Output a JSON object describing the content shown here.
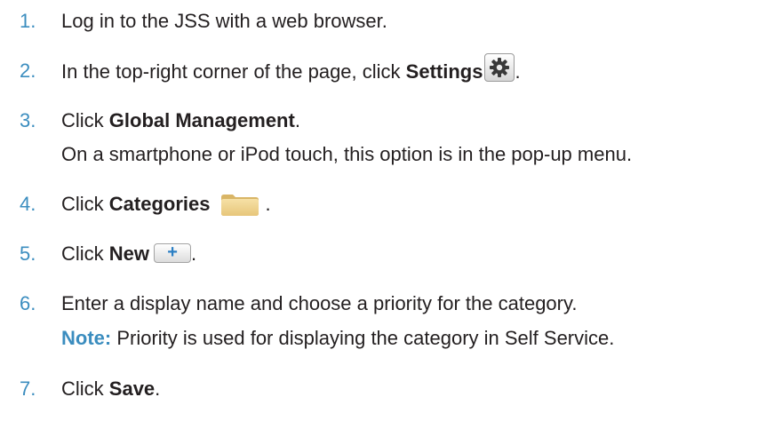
{
  "steps": [
    {
      "number": "1.",
      "text": "Log in to the JSS with a web browser."
    },
    {
      "number": "2.",
      "text_before": "In the top-right corner of the page, click ",
      "bold": "Settings",
      "text_after": ".",
      "icon": "gear-icon"
    },
    {
      "number": "3.",
      "text_before": "Click ",
      "bold": "Global Management",
      "text_after": ".",
      "subtext": "On a smartphone or iPod touch, this option is in the pop-up menu."
    },
    {
      "number": "4.",
      "text_before": "Click ",
      "bold": "Categories",
      "text_after": ".",
      "icon": "folder-icon"
    },
    {
      "number": "5.",
      "text_before": "Click ",
      "bold": "New",
      "text_after": ".",
      "icon": "plus-icon",
      "icon_glyph": "+"
    },
    {
      "number": "6.",
      "text": "Enter a display name and choose a priority for the category.",
      "note_label": "Note:",
      "note_text": " Priority is used for displaying the category in Self Service."
    },
    {
      "number": "7.",
      "text_before": "Click ",
      "bold": "Save",
      "text_after": "."
    }
  ],
  "colors": {
    "step_number": "#3b8dbf",
    "note_label": "#3b8dbf",
    "body_text": "#231f20"
  }
}
